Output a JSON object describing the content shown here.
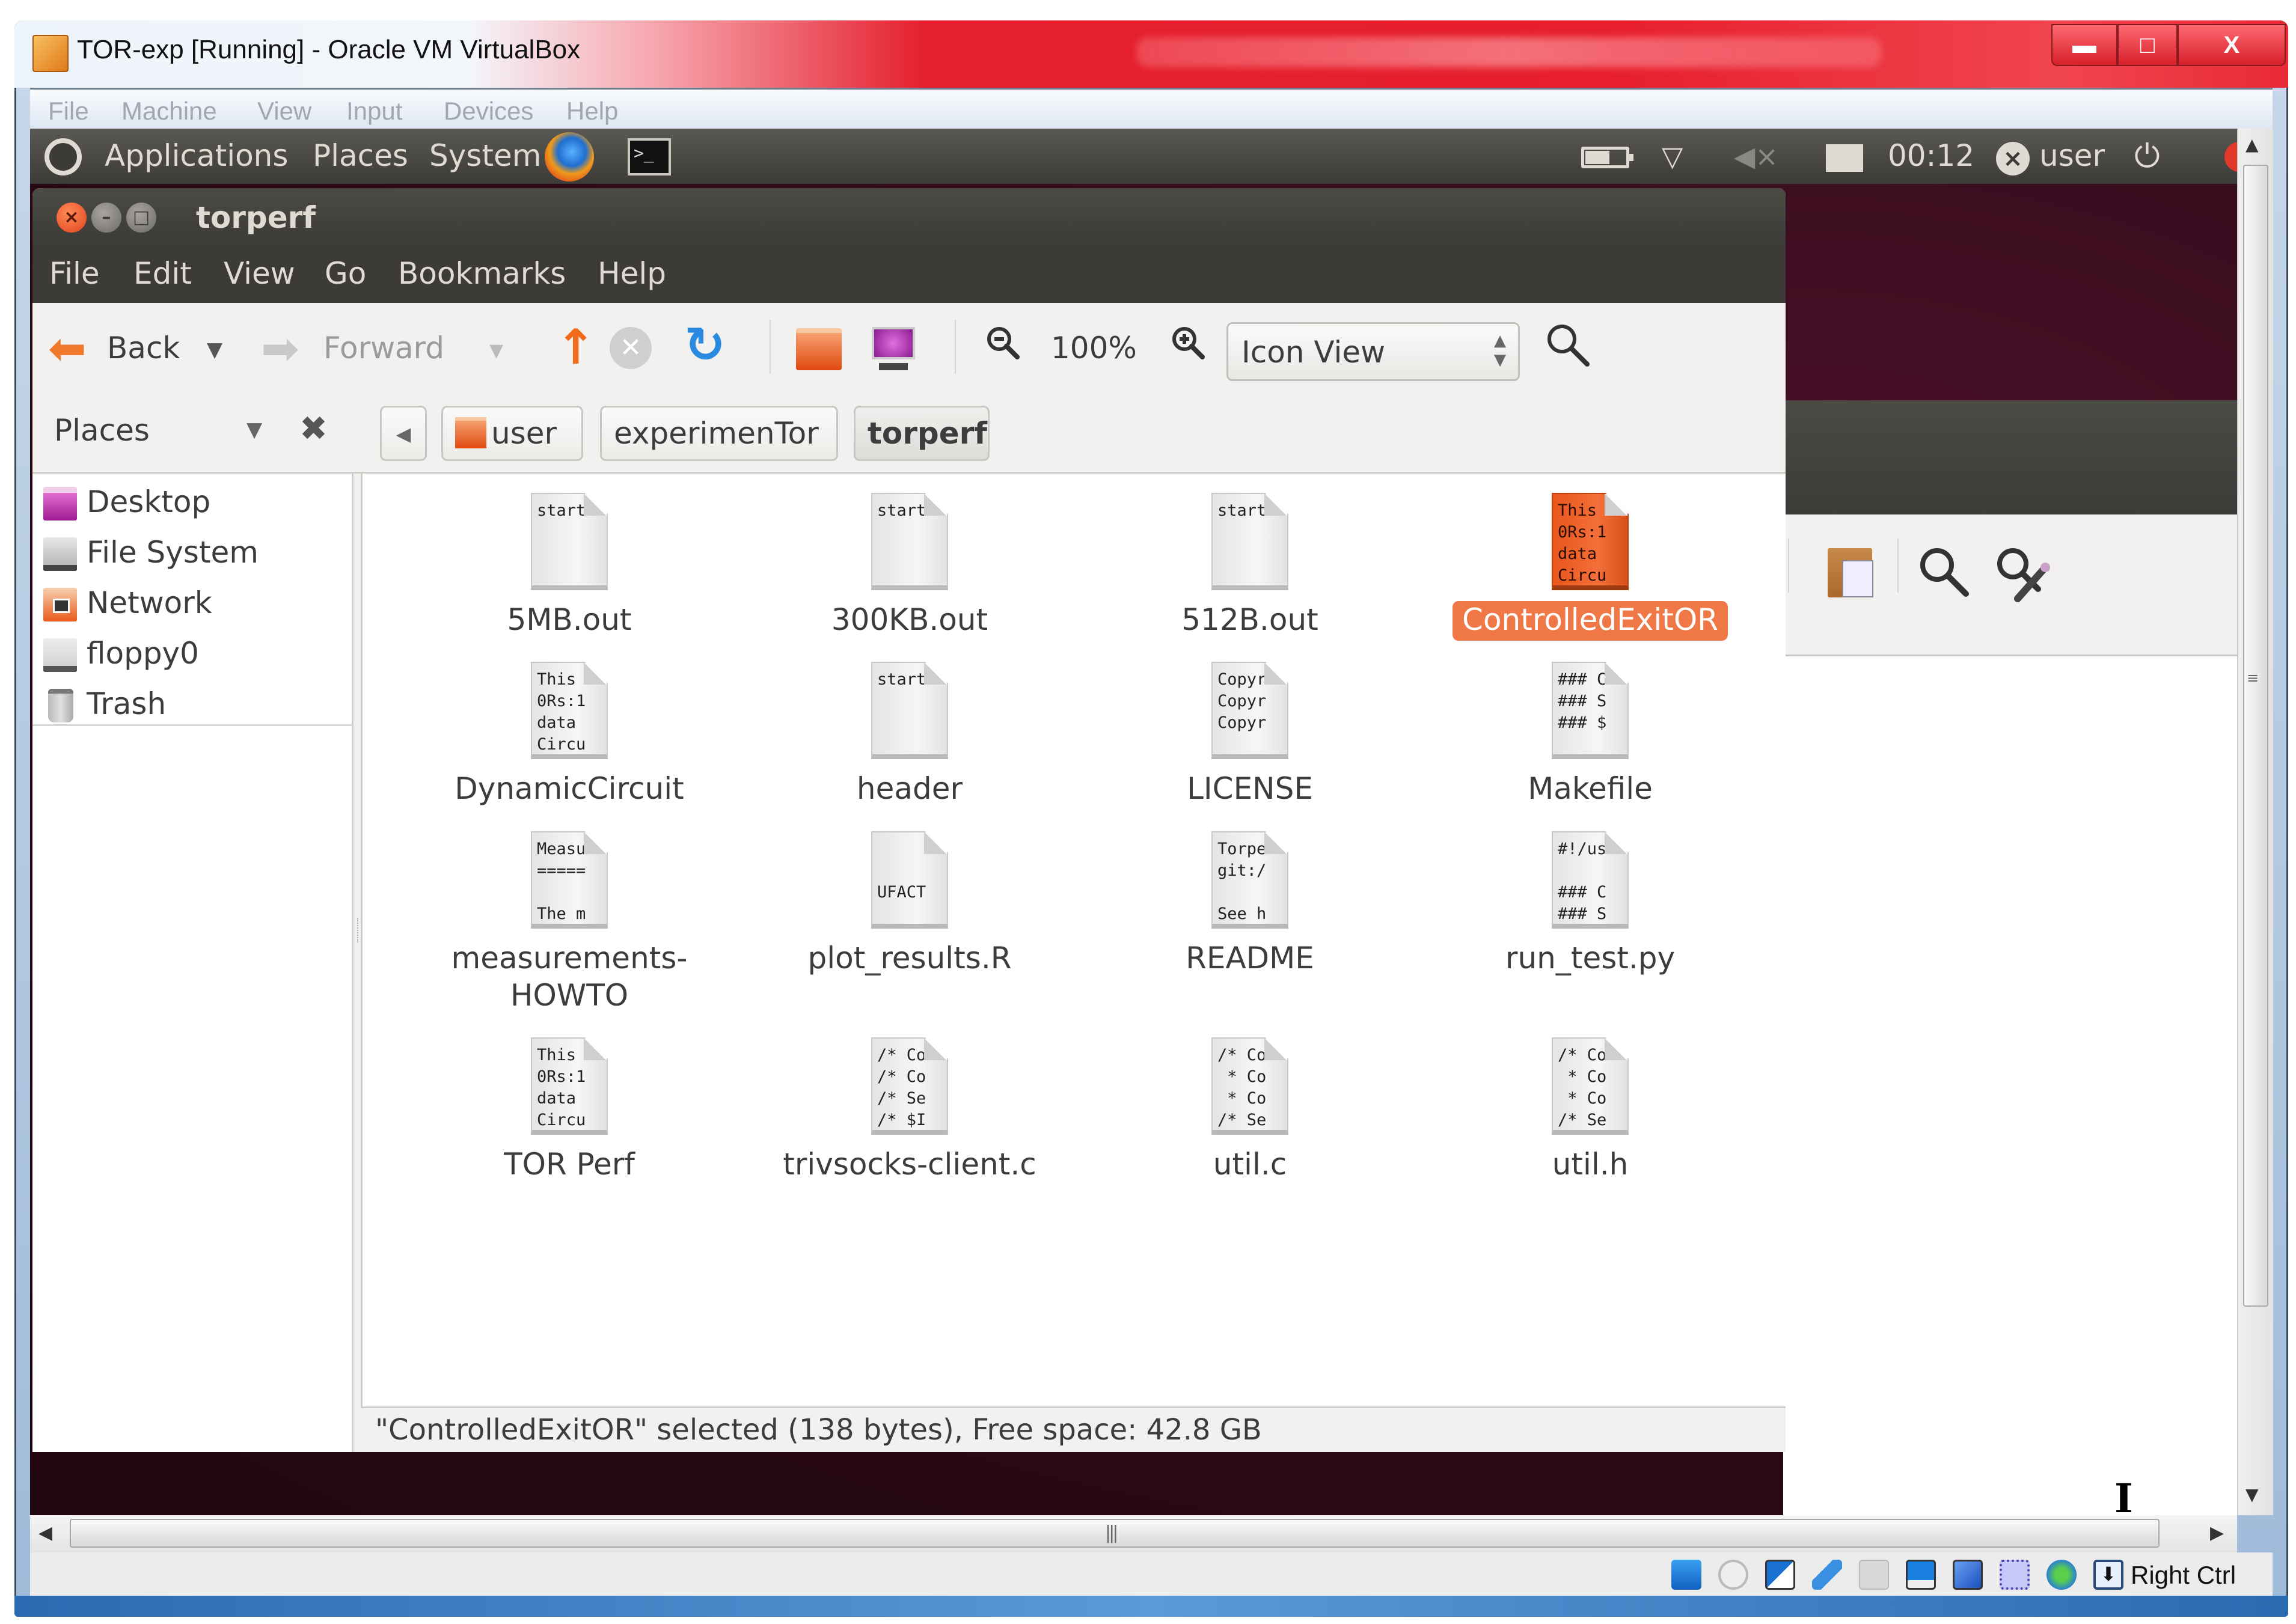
{
  "vbox": {
    "title": "TOR-exp [Running] - Oracle VM VirtualBox",
    "window_controls": {
      "minimize": "▬",
      "maximize": "□",
      "close": "X"
    },
    "menu": [
      "File",
      "Machine",
      "View",
      "Input",
      "Devices",
      "Help"
    ],
    "host_key": "Right Ctrl",
    "status_icons": [
      "hard-disk",
      "optical-drive",
      "network",
      "usb",
      "shared-folders",
      "display",
      "video-capture",
      "cpu-virtualization",
      "mouse-integration",
      "host-key-capture"
    ]
  },
  "ubuntu_panel": {
    "menus": [
      "Applications",
      "Places",
      "System"
    ],
    "clock": "00:12",
    "user": "user",
    "launchers": [
      "firefox",
      "terminal"
    ],
    "tray": [
      "battery",
      "network",
      "volume-muted",
      "mail",
      "user-status",
      "power"
    ]
  },
  "nautilus": {
    "title": "torperf",
    "menu": [
      "File",
      "Edit",
      "View",
      "Go",
      "Bookmarks",
      "Help"
    ],
    "toolbar": {
      "back_label": "Back",
      "forward_label": "Forward",
      "zoom_level": "100%",
      "view_mode": "Icon View"
    },
    "sidebar": {
      "header": "Places",
      "items": [
        {
          "label": "Desktop",
          "icon": "desktop-icon"
        },
        {
          "label": "File System",
          "icon": "filesystem-icon"
        },
        {
          "label": "Network",
          "icon": "network-icon"
        },
        {
          "label": "floppy0",
          "icon": "floppy-icon"
        },
        {
          "label": "Trash",
          "icon": "trash-icon"
        }
      ]
    },
    "breadcrumbs": [
      "user",
      "experimenTor",
      "torperf"
    ],
    "files": [
      {
        "name": "5MB.out",
        "preview": "start",
        "selected": false
      },
      {
        "name": "300KB.out",
        "preview": "start",
        "selected": false
      },
      {
        "name": "512B.out",
        "preview": "start",
        "selected": false
      },
      {
        "name": "ControlledExitOR",
        "preview": "This\n0Rs:1\ndata\nCircu",
        "selected": true
      },
      {
        "name": "DynamicCircuit",
        "preview": "This\n0Rs:1\ndata\nCircu",
        "selected": false
      },
      {
        "name": "header",
        "preview": "start",
        "selected": false
      },
      {
        "name": "LICENSE",
        "preview": "Copyr\nCopyr\nCopyr",
        "selected": false
      },
      {
        "name": "Makefile",
        "preview": "### C\n### S\n### $",
        "selected": false
      },
      {
        "name": "measurements-HOWTO",
        "preview": "Measu\n=====\n\nThe m",
        "selected": false
      },
      {
        "name": "plot_results.R",
        "preview": "\n\nUFACT",
        "selected": false
      },
      {
        "name": "README",
        "preview": "Torpe\ngit:/\n\nSee h",
        "selected": false
      },
      {
        "name": "run_test.py",
        "preview": "#!/us\n\n### C\n### S",
        "selected": false
      },
      {
        "name": "TOR Perf",
        "preview": "This\n0Rs:1\ndata\nCircu",
        "selected": false
      },
      {
        "name": "trivsocks-client.c",
        "preview": "/* Co\n/* Co\n/* Se\n/* $I",
        "selected": false
      },
      {
        "name": "util.c",
        "preview": "/* Co\n * Co\n * Co\n/* Se",
        "selected": false
      },
      {
        "name": "util.h",
        "preview": "/* Co\n * Co\n * Co\n/* Se",
        "selected": false
      }
    ],
    "status": "\"ControlledExitOR\" selected (138 bytes), Free space: 42.8 GB"
  },
  "colors": {
    "selection": "#f07746",
    "ubuntu_panel": "#3c3b37",
    "wallpaper": "#2c0a16",
    "vbox_titlebar": "#e71e2b"
  }
}
